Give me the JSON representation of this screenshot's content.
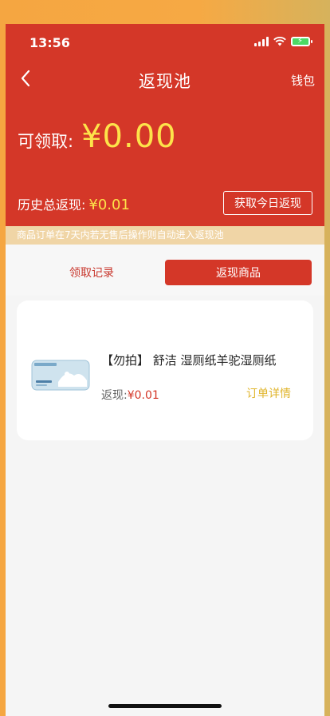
{
  "status_bar": {
    "time": "13:56"
  },
  "nav": {
    "title": "返现池",
    "wallet": "钱包"
  },
  "header": {
    "claim_label": "可领取:",
    "claim_amount": "¥0.00",
    "history_label": "历史总返现:",
    "history_amount": "¥0.01",
    "get_today_button": "获取今日返现"
  },
  "notice": "商品订单在7天内若无售后操作则自动进入返现池",
  "tabs": [
    {
      "label": "领取记录",
      "active": false
    },
    {
      "label": "返现商品",
      "active": true
    }
  ],
  "products": [
    {
      "title": "【勿拍】 舒洁 湿厕纸羊驼湿厕纸",
      "cashback_label": "返现:",
      "cashback_amount": "¥0.01",
      "detail_link": "订单详情"
    }
  ],
  "colors": {
    "primary_red": "#d43728",
    "amount_yellow": "#fde34a",
    "detail_gold": "#e0b52c",
    "notice_bg": "#f0d5a6"
  },
  "icons": [
    "back-icon",
    "signal-icon",
    "wifi-icon",
    "battery-icon"
  ]
}
